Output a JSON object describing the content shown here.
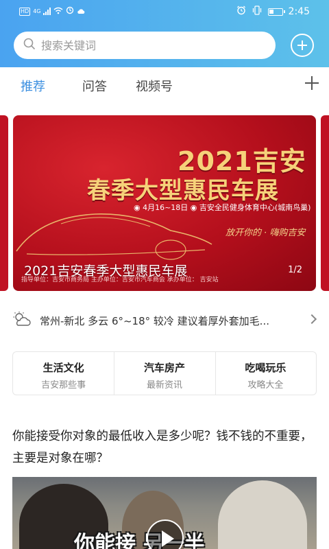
{
  "status_bar": {
    "hd": "HD",
    "network": "4G",
    "time": "2:45"
  },
  "search": {
    "placeholder": "搜索关键词"
  },
  "tabs": [
    {
      "label": "推荐",
      "active": true
    },
    {
      "label": "问答"
    },
    {
      "label": "视频号"
    }
  ],
  "banner": {
    "title_line1": "2021吉安",
    "title_line2": "春季大型惠民车展",
    "info": "◉ 4月16~18日   ◉ 吉安全民健身体育中心(城南鸟巢)",
    "slogan": "放开你的 · 嗨购吉安",
    "caption": "2021吉安春季大型惠民车展",
    "page": "1/2",
    "sponsor": "指导单位：吉安市商务局    主办单位：吉安市汽车商会    承办单位：    吉安站"
  },
  "weather": {
    "text": "常州-新北 多云 6°~18° 较冷 建议着厚外套加毛..."
  },
  "categories": [
    {
      "title": "生活文化",
      "sub": "吉安那些事"
    },
    {
      "title": "汽车房产",
      "sub": "最新资讯"
    },
    {
      "title": "吃喝玩乐",
      "sub": "攻略大全"
    }
  ],
  "article": {
    "title": "你能接受你对象的最低收入是多少呢？钱不钱的不重要，主要是对象在哪？",
    "video_caption": "你能接  另一半"
  },
  "colors": {
    "header_gradient_start": "#4aa3f0",
    "header_gradient_end": "#5dc1ea",
    "tab_active": "#3b8fe0",
    "banner_red": "#c01223",
    "banner_gold": "#f6d27a"
  }
}
